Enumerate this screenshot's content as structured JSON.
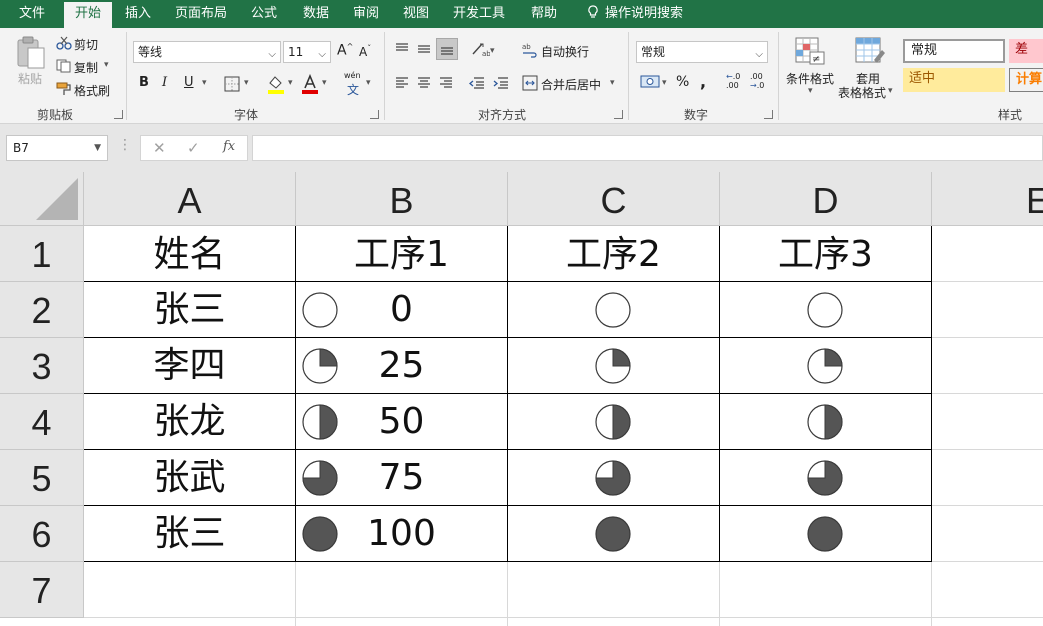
{
  "ribbon_tabs": [
    {
      "label": "文件",
      "active": false
    },
    {
      "label": "开始",
      "active": true
    },
    {
      "label": "插入",
      "active": false
    },
    {
      "label": "页面布局",
      "active": false
    },
    {
      "label": "公式",
      "active": false
    },
    {
      "label": "数据",
      "active": false
    },
    {
      "label": "审阅",
      "active": false
    },
    {
      "label": "视图",
      "active": false
    },
    {
      "label": "开发工具",
      "active": false
    },
    {
      "label": "帮助",
      "active": false
    }
  ],
  "tell_me": "操作说明搜索",
  "clipboard": {
    "paste": "粘贴",
    "cut": "剪切",
    "copy": "复制",
    "format_painter": "格式刷",
    "group_label": "剪贴板"
  },
  "font": {
    "name": "等线",
    "size": "11",
    "bold": "B",
    "italic": "I",
    "underline": "U",
    "phonetic": "wén",
    "phonetic_char": "文",
    "grow": "A",
    "shrink": "A",
    "group_label": "字体"
  },
  "alignment": {
    "wrap_text": "自动换行",
    "merge_center": "合并后居中",
    "group_label": "对齐方式"
  },
  "number": {
    "format": "常规",
    "percent": "%",
    "comma": ",",
    "inc_decimal": ".00",
    "dec_decimal": ".0",
    "group_label": "数字"
  },
  "styles": {
    "conditional": "条件格式",
    "table_format_line1": "套用",
    "table_format_line2": "表格格式",
    "normal": "常规",
    "bad": "差",
    "neutral": "适中",
    "calc": "计算",
    "group_label": "样式"
  },
  "formula_bar": {
    "name_box": "B7",
    "cancel": "✕",
    "enter": "✓",
    "fx": "fx",
    "value": ""
  },
  "columns": [
    "A",
    "B",
    "C",
    "D",
    "E"
  ],
  "rows": [
    "1",
    "2",
    "3",
    "4",
    "5",
    "6",
    "7"
  ],
  "sheet": {
    "header": [
      "姓名",
      "工序1",
      "工序2",
      "工序3"
    ],
    "names": [
      "张三",
      "李四",
      "张龙",
      "张武",
      "张三"
    ],
    "b_values": [
      "0",
      "25",
      "50",
      "75",
      "100"
    ],
    "progress_percent": [
      0,
      25,
      50,
      75,
      100
    ]
  },
  "colors": {
    "accent": "#217346",
    "pie_fill": "#555555",
    "bad_bg": "#ffc7ce",
    "bad_text": "#9c0006",
    "neutral_bg": "#ffeb9c",
    "neutral_text": "#9c5700",
    "calc_text": "#fa7d00"
  }
}
